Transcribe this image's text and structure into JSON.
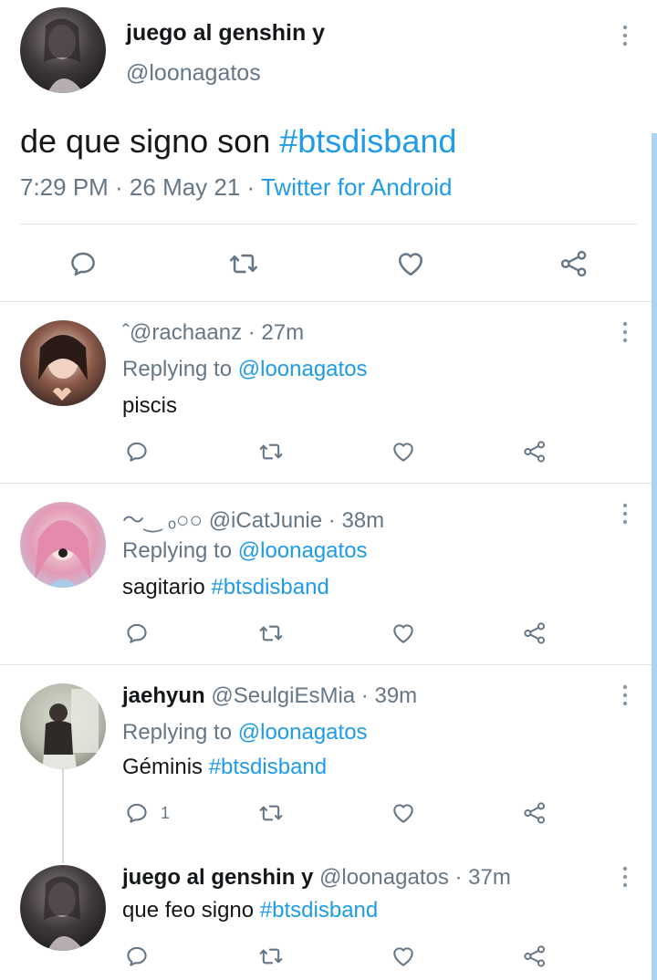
{
  "main_tweet": {
    "name": "juego al genshin y",
    "handle": "@loonagatos",
    "text": "de que signo son ",
    "hashtag": "#btsdisband",
    "time_date": "7:29 PM · 26 May 21 · ",
    "client": "Twitter for Android",
    "actions": [
      "reply-icon",
      "retweet-icon",
      "like-icon",
      "share-icon"
    ]
  },
  "replies": [
    {
      "name_decor": "ˆ",
      "name": "",
      "handle": "@rachaanz",
      "time": " · 27m",
      "replying_label": "Replying to ",
      "replying_to": "@loonagatos",
      "text": "piscis",
      "hashtag": "",
      "reply_count": ""
    },
    {
      "name_decor": "〜‿ ₒ○○ ",
      "name": "",
      "handle": "@iCatJunie",
      "time": " · 38m",
      "replying_label": "Replying to ",
      "replying_to": "@loonagatos",
      "text": "sagitario ",
      "hashtag": "#btsdisband",
      "reply_count": ""
    },
    {
      "name_decor": "",
      "name": "jaehyun",
      "handle": " @SeulgiEsMia",
      "time": " · 39m",
      "replying_label": "Replying to ",
      "replying_to": "@loonagatos",
      "text": "Géminis ",
      "hashtag": "#btsdisband",
      "reply_count": "1"
    },
    {
      "name_decor": "",
      "name": "juego al genshin y",
      "handle": " @loonagatos",
      "time": " · 37m",
      "replying_label": "",
      "replying_to": "",
      "text": "que feo signo ",
      "hashtag": "#btsdisband",
      "reply_count": ""
    }
  ],
  "colors": {
    "link": "#1f9be8",
    "muted": "#657786",
    "text": "#14171a",
    "scrollbar": "#a9d3f2"
  }
}
